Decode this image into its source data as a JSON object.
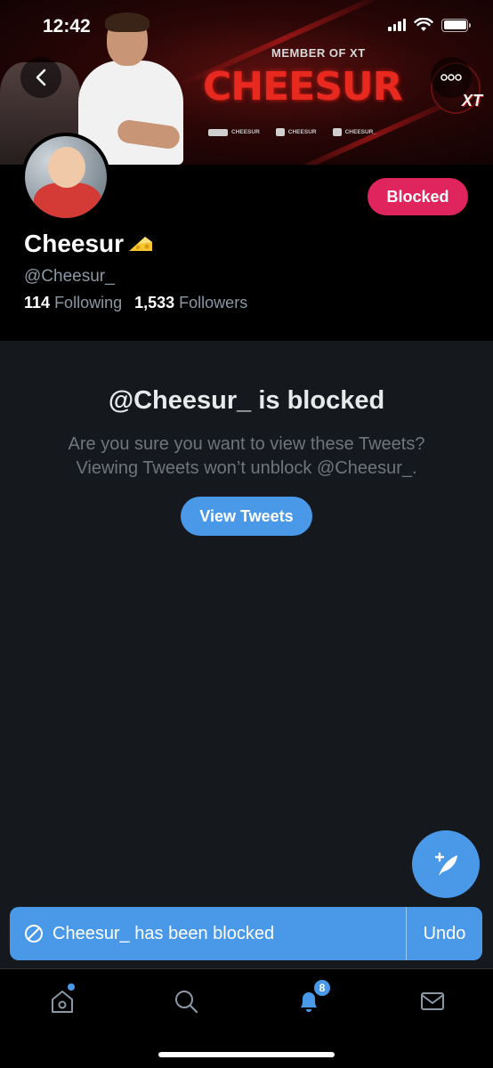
{
  "status_bar": {
    "time": "12:42"
  },
  "banner": {
    "member_text": "MEMBER OF XT",
    "brand_name": "CHEESUR",
    "logo_text": "XT",
    "socials": [
      {
        "platform": "twitch",
        "handle": "CHEESUR"
      },
      {
        "platform": "youtube",
        "handle": "CHEESUR"
      },
      {
        "platform": "twitter",
        "handle": "CHEESUR_"
      }
    ]
  },
  "profile": {
    "display_name": "Cheesur",
    "name_emoji": "cheese-icon",
    "handle": "@Cheesur_",
    "following_count": "114",
    "following_label": "Following",
    "followers_count": "1,533",
    "followers_label": "Followers",
    "blocked_label": "Blocked"
  },
  "blocked_notice": {
    "title": "@Cheesur_ is blocked",
    "line1": "Are you sure you want to view these Tweets?",
    "line2": "Viewing Tweets won’t unblock @Cheesur_.",
    "button_label": "View Tweets"
  },
  "toast": {
    "message": "Cheesur_ has been blocked",
    "undo_label": "Undo"
  },
  "tab_bar": {
    "notifications_badge": "8",
    "tabs": [
      "home-icon",
      "search-icon",
      "notifications-icon",
      "messages-icon"
    ]
  },
  "colors": {
    "accent": "#4a99e9",
    "blocked": "#e0245e",
    "panel_bg": "#15181c",
    "secondary_text": "#8b98a5"
  }
}
